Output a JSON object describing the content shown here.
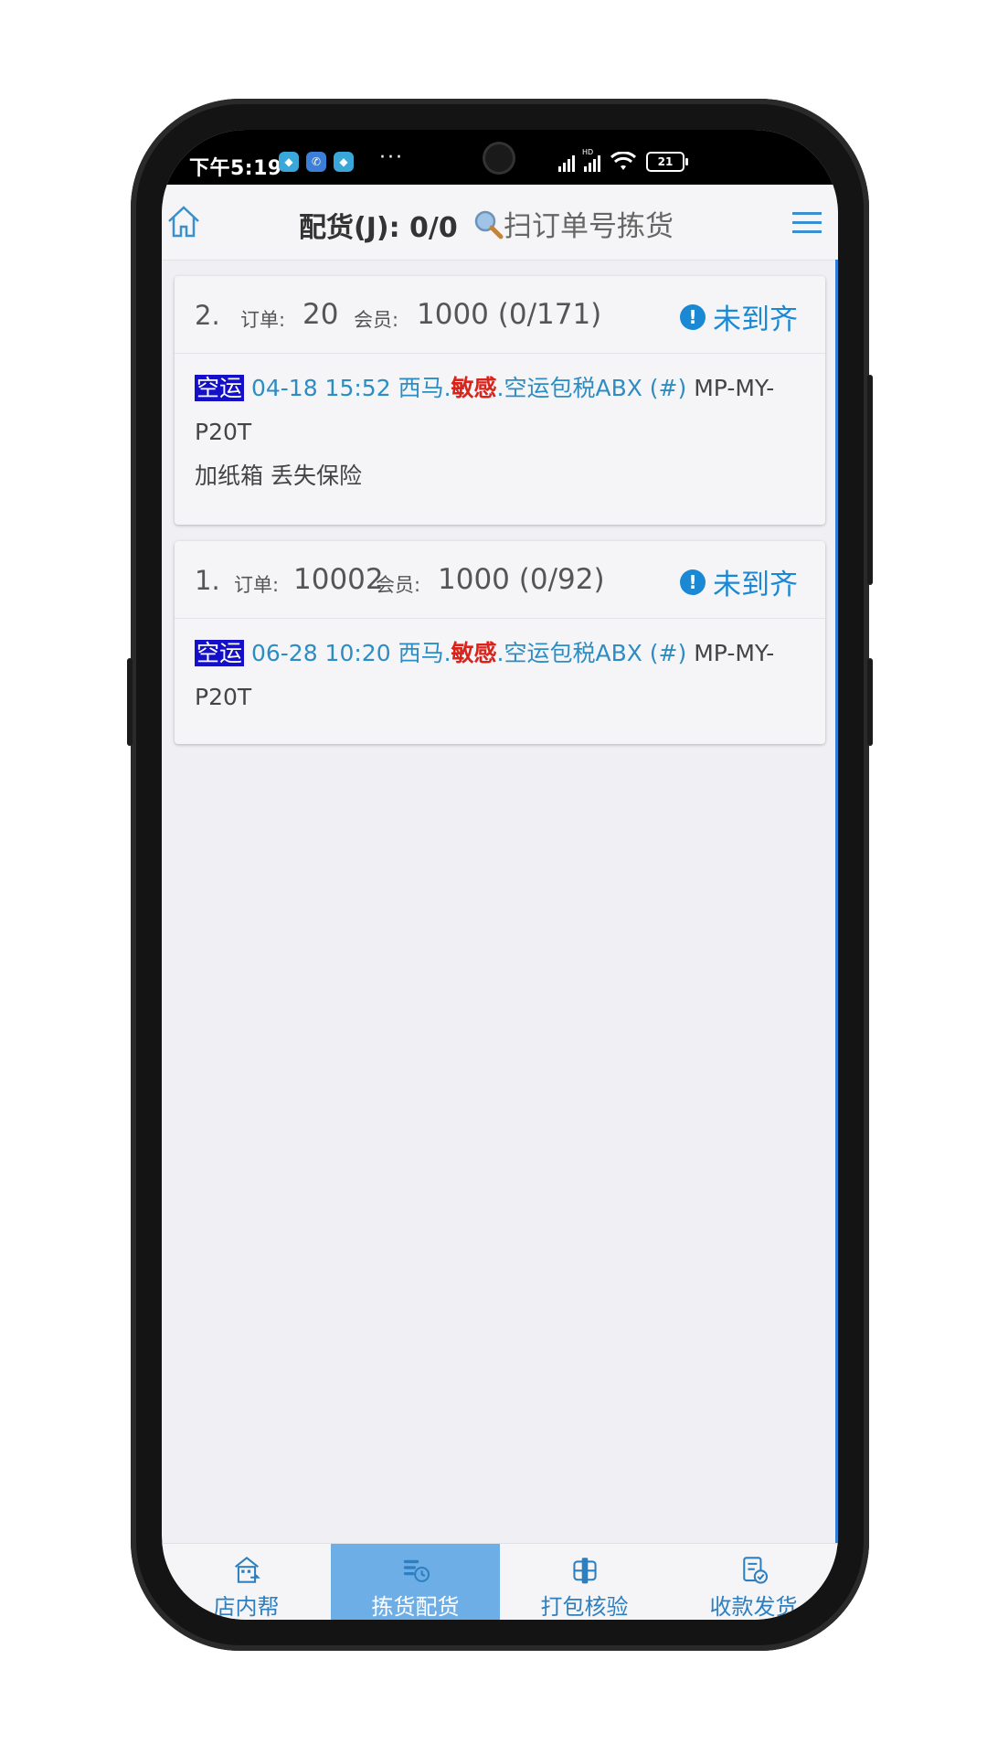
{
  "status_bar": {
    "time": "下午5:19",
    "more": "···",
    "battery": "21",
    "hd_label": "HD"
  },
  "header": {
    "title": "配货(J): 0/0",
    "scan_label": "扫订单号拣货"
  },
  "orders": [
    {
      "index": "2.",
      "order_label": "订单:",
      "order_no": "20",
      "member_label": "会员:",
      "member_value": "1000 (0/171)",
      "status": "未到齐",
      "tag": "空运",
      "datetime": "04-18 15:52",
      "region": "西马.",
      "sensitive": "敏感",
      "service": ".空运包税ABX (#)",
      "code": "MP-MY-P20T",
      "extras": "加纸箱 丢失保险"
    },
    {
      "index": "1.",
      "order_label": "订单:",
      "order_no": "10002",
      "member_label": "会员:",
      "member_value": "1000 (0/92)",
      "status": "未到齐",
      "tag": "空运",
      "datetime": "06-28 10:20",
      "region": "西马.",
      "sensitive": "敏感",
      "service": ".空运包税ABX (#)",
      "code": "MP-MY-P20T"
    }
  ],
  "bottom_nav": [
    {
      "label": "店内帮",
      "icon": "store-icon"
    },
    {
      "label": "拣货配货",
      "icon": "picking-icon"
    },
    {
      "label": "打包核验",
      "icon": "pack-icon"
    },
    {
      "label": "收款发货",
      "icon": "checklist-icon"
    }
  ],
  "colors": {
    "accent": "#1b88d4",
    "tag_bg": "#1410c9",
    "sensitive": "#d9241c",
    "nav_active": "#6daee6"
  }
}
